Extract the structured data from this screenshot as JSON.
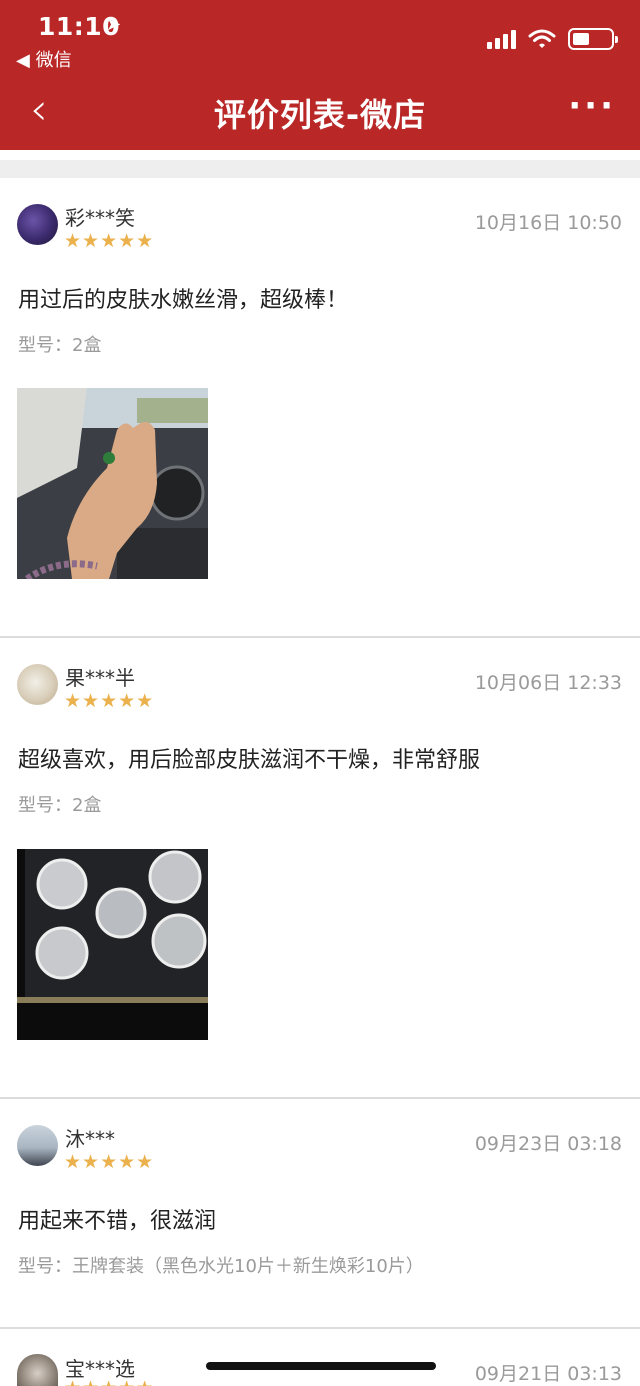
{
  "status_bar": {
    "time": "11:10",
    "back_app": "◀ 微信"
  },
  "nav": {
    "title": "评价列表-微店",
    "back_glyph": "‹",
    "more_glyph": "···"
  },
  "reviews": [
    {
      "user": "彩***笑",
      "stars": "★★★★★",
      "rating": 5,
      "date": "10月16日 10:50",
      "content": "用过后的皮肤水嫩丝滑，超级棒！",
      "spec": "型号：2盒"
    },
    {
      "user": "果***半",
      "stars": "★★★★★",
      "rating": 5,
      "date": "10月06日 12:33",
      "content": "超级喜欢，用后脸部皮肤滋润不干燥，非常舒服",
      "spec": "型号：2盒"
    },
    {
      "user": "沐***",
      "stars": "★★★★★",
      "rating": 5,
      "date": "09月23日 03:18",
      "content": "用起来不错，很滋润",
      "spec": "型号：王牌套装（黑色水光10片＋新生焕彩10片）"
    },
    {
      "user": "宝***选",
      "stars": "★★★★★",
      "rating": 5,
      "date": "09月21日 03:13"
    }
  ],
  "colors": {
    "header": "#b92727",
    "stars": "#eab14c",
    "muted": "#9a9a9a"
  }
}
